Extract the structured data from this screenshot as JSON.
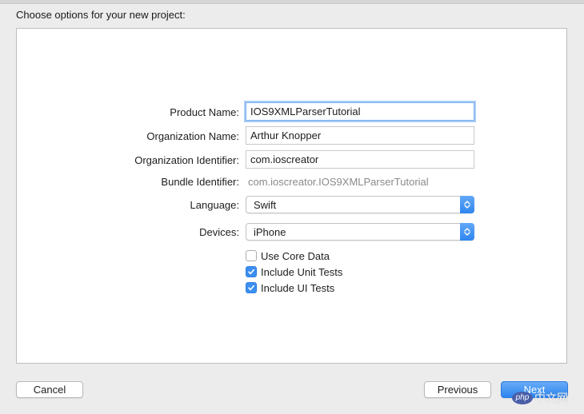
{
  "header": {
    "title": "Choose options for your new project:"
  },
  "form": {
    "product_name": {
      "label": "Product Name:",
      "value": "IOS9XMLParserTutorial"
    },
    "organization_name": {
      "label": "Organization Name:",
      "value": "Arthur Knopper"
    },
    "organization_identifier": {
      "label": "Organization Identifier:",
      "value": "com.ioscreator"
    },
    "bundle_identifier": {
      "label": "Bundle Identifier:",
      "value": "com.ioscreator.IOS9XMLParserTutorial"
    },
    "language": {
      "label": "Language:",
      "value": "Swift"
    },
    "devices": {
      "label": "Devices:",
      "value": "iPhone"
    },
    "checkboxes": [
      {
        "label": "Use Core Data",
        "checked": false
      },
      {
        "label": "Include Unit Tests",
        "checked": true
      },
      {
        "label": "Include UI Tests",
        "checked": true
      }
    ]
  },
  "buttons": {
    "cancel": "Cancel",
    "previous": "Previous",
    "next": "Next"
  },
  "watermark": {
    "badge": "php",
    "text": "中文网"
  },
  "colors": {
    "accent": "#3b8ff0",
    "window_background": "#ececec",
    "panel_background": "#ffffff"
  },
  "icons": [
    "popup-arrows-icon",
    "checkmark-icon"
  ]
}
